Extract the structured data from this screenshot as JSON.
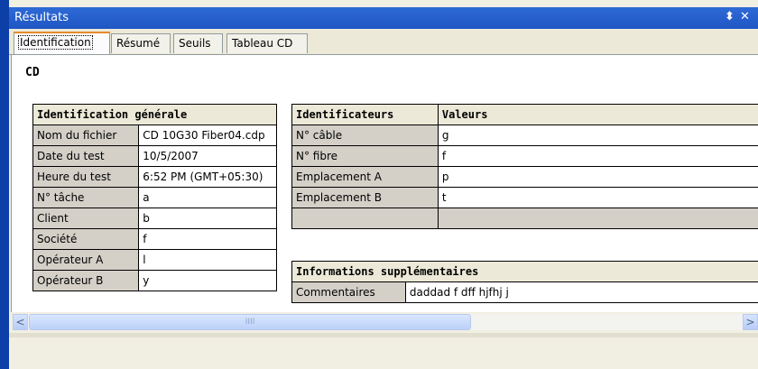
{
  "window": {
    "title": "Résultats",
    "pin_glyph": "⬍",
    "close_glyph": "✕"
  },
  "tabs": [
    {
      "label": "Identification",
      "active": true
    },
    {
      "label": "Résumé",
      "active": false
    },
    {
      "label": "Seuils",
      "active": false
    },
    {
      "label": "Tableau CD",
      "active": false
    }
  ],
  "content": {
    "heading": "CD",
    "general": {
      "header": "Identification générale",
      "rows": [
        {
          "label": "Nom du fichier",
          "value": "CD 10G30 Fiber04.cdp"
        },
        {
          "label": "Date du test",
          "value": "10/5/2007"
        },
        {
          "label": "Heure du test",
          "value": "6:52 PM (GMT+05:30)"
        },
        {
          "label": "N° tâche",
          "value": "a"
        },
        {
          "label": "Client",
          "value": "b"
        },
        {
          "label": "Société",
          "value": "f"
        },
        {
          "label": "Opérateur A",
          "value": "l"
        },
        {
          "label": "Opérateur B",
          "value": "y"
        }
      ]
    },
    "identifiers": {
      "header_left": "Identificateurs",
      "header_right": "Valeurs",
      "rows": [
        {
          "label": "N° câble",
          "value": "g"
        },
        {
          "label": "N° fibre",
          "value": "f"
        },
        {
          "label": "Emplacement A",
          "value": "p"
        },
        {
          "label": "Emplacement B",
          "value": "t"
        }
      ]
    },
    "extra": {
      "header": "Informations supplémentaires",
      "label": "Commentaires",
      "value": "daddad f  dff hjfhj j"
    }
  },
  "scrollbar": {
    "left_arrow": "<",
    "right_arrow": ">",
    "grip": "IIII"
  }
}
